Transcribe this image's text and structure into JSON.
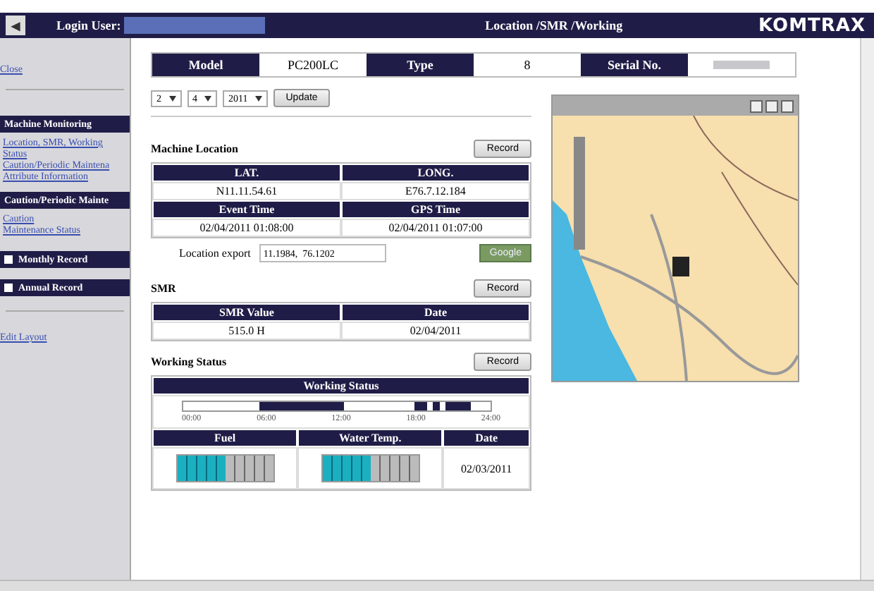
{
  "header": {
    "back": "◀",
    "login_label": "Login User:",
    "title": "Location /SMR /Working",
    "logo": "KOMTRAX"
  },
  "sidebar": {
    "close": "Close",
    "sections": [
      {
        "title": "Machine Monitoring",
        "kind": "header",
        "links": [
          "Location, SMR, Working Status",
          "Caution/Periodic Maintena",
          "Attribute Information"
        ]
      },
      {
        "title": "Caution/Periodic Mainte",
        "kind": "header",
        "links": [
          "Caution",
          "Maintenance Status"
        ]
      },
      {
        "title": "Monthly Record",
        "kind": "expander"
      },
      {
        "title": "Annual Record",
        "kind": "expander"
      }
    ],
    "edit_layout": "Edit Layout"
  },
  "info": [
    {
      "label": "Model",
      "value": "PC200LC"
    },
    {
      "label": "Type",
      "value": "8"
    },
    {
      "label": "Serial No."
    }
  ],
  "date_selects": [
    "2",
    "4",
    "2011"
  ],
  "update": "Update",
  "machine_location": {
    "title": "Machine Location",
    "record": "Record",
    "rows": [
      [
        "LAT.",
        "LONG."
      ],
      [
        "N11.11.54.61",
        "E76.7.12.184"
      ],
      [
        "Event Time",
        "GPS Time"
      ],
      [
        "02/04/2011 01:08:00",
        "02/04/2011 01:07:00"
      ]
    ],
    "export_label": "Location export",
    "export_value": "11.1984,  76.1202",
    "google": "Google"
  },
  "smr": {
    "title": "SMR",
    "record": "Record",
    "columns": [
      "SMR Value",
      "Date"
    ],
    "values": [
      "515.0 H",
      "02/04/2011"
    ]
  },
  "working_status": {
    "title": "Working Status",
    "record": "Record",
    "bar_title": "Working Status",
    "ticks": [
      "00:00",
      "06:00",
      "12:00",
      "18:00",
      "24:00"
    ],
    "columns": [
      "Fuel",
      "Water Temp.",
      "Date"
    ],
    "fuel": {
      "level": 0.5
    },
    "water": {
      "level": 0.5
    },
    "date": "02/03/2011"
  }
}
